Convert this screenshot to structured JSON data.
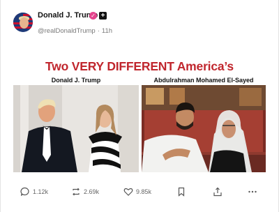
{
  "post": {
    "author_name": "Donald J. Trump",
    "verified_mark": "✓",
    "badge_mark": "+",
    "handle": "@realDonaldTrump",
    "separator": "·",
    "timestamp": "11h"
  },
  "image": {
    "headline": "Two VERY DIFFERENT America’s",
    "left_label": "Donald J. Trump",
    "right_label": "Abdulrahman Mohamed El-Sayed"
  },
  "actions": {
    "comments": "1.12k",
    "reposts": "2.69k",
    "likes": "9.85k"
  },
  "colors": {
    "headline_red": "#c0262d",
    "verified_pink": "#e4458e",
    "muted_text": "#7a7a7a"
  }
}
